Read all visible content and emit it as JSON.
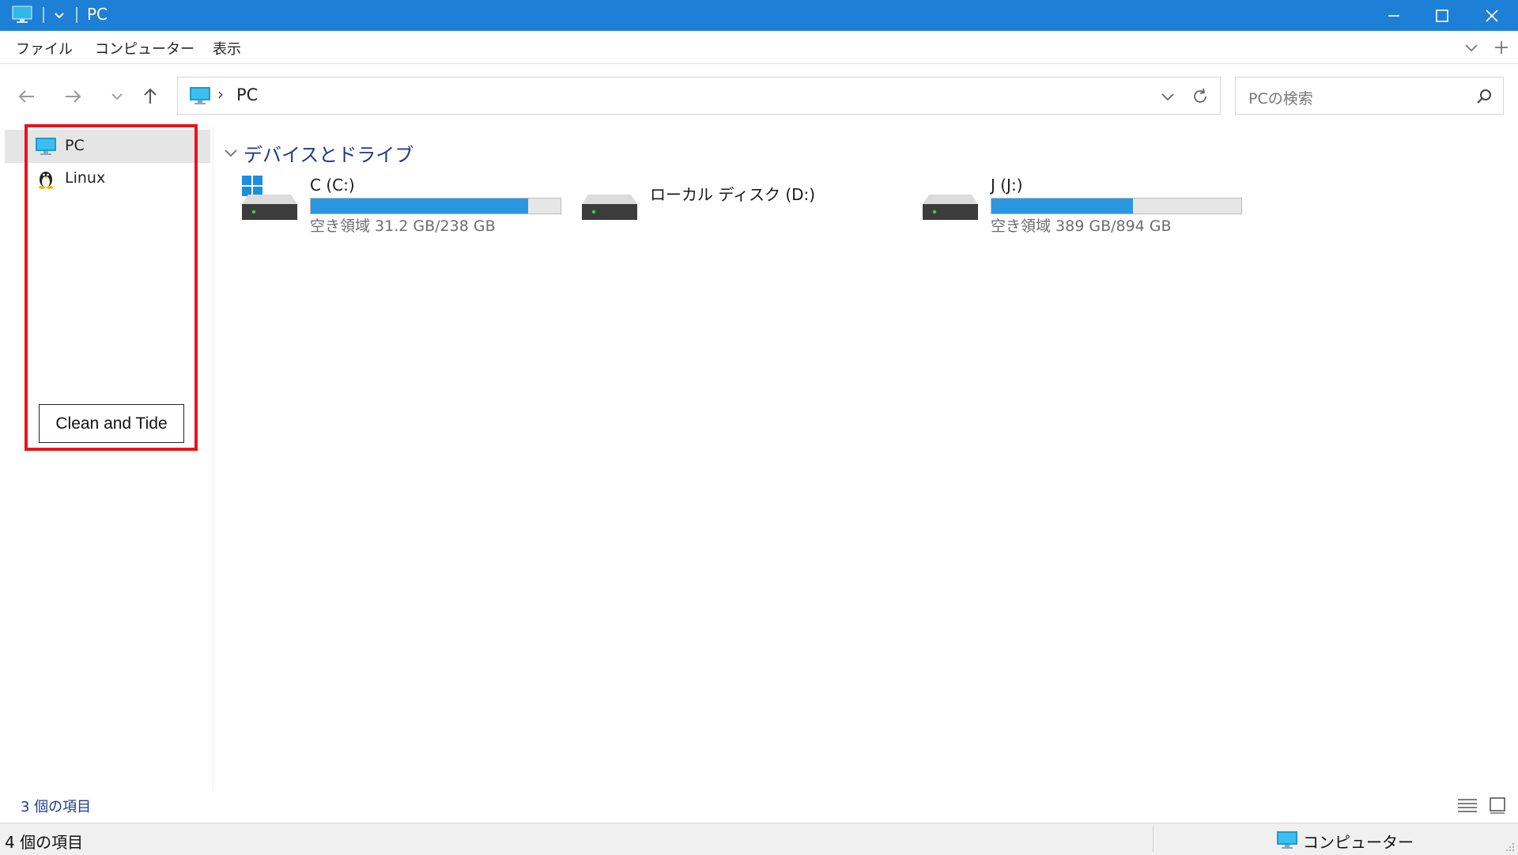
{
  "window": {
    "title": "PC",
    "accent_color": "#1d80d6",
    "controls": [
      "minimize-icon",
      "maximize-icon",
      "close-icon"
    ]
  },
  "menu": {
    "items": [
      "ファイル",
      "コンピューター",
      "表示"
    ],
    "right_icons": [
      "chevron-down-icon",
      "plus-icon"
    ]
  },
  "navigation": {
    "buttons": [
      "back-arrow-icon",
      "forward-arrow-icon",
      "history-dropdown-icon",
      "up-arrow-icon"
    ],
    "address": {
      "icon": "pc-monitor-icon",
      "separator": "›",
      "path": "PC"
    },
    "search_placeholder": "PCの検索"
  },
  "sidebar": {
    "items": [
      {
        "label": "PC",
        "icon": "pc-monitor-icon",
        "selected": true
      },
      {
        "label": "Linux",
        "icon": "linux-penguin-icon",
        "selected": false
      }
    ],
    "annotation": {
      "text": "Clean and Tide",
      "highlight_color": "#e6141d"
    }
  },
  "main": {
    "section_title": "デバイスとドライブ",
    "drives": [
      {
        "name": "C (C:)",
        "free_text": "空き領域 31.2 GB/238 GB",
        "used_fraction": 0.87,
        "bar_color": "#2a98e0",
        "has_windows_logo": true
      },
      {
        "name": "ローカル ディスク (D:)",
        "free_text": "",
        "used_fraction": null,
        "bar_color": "",
        "has_windows_logo": false
      },
      {
        "name": "J (J:)",
        "free_text": "空き領域 389 GB/894 GB",
        "used_fraction": 0.565,
        "bar_color": "#2a98e0",
        "has_windows_logo": false
      }
    ]
  },
  "footer": {
    "item_count": "3 個の項目",
    "view_buttons": [
      "details-view-icon",
      "large-icons-view-icon"
    ]
  },
  "statusbar": {
    "left_text": "4 個の項目",
    "right_text": "コンピューター",
    "right_icon": "pc-monitor-icon"
  }
}
